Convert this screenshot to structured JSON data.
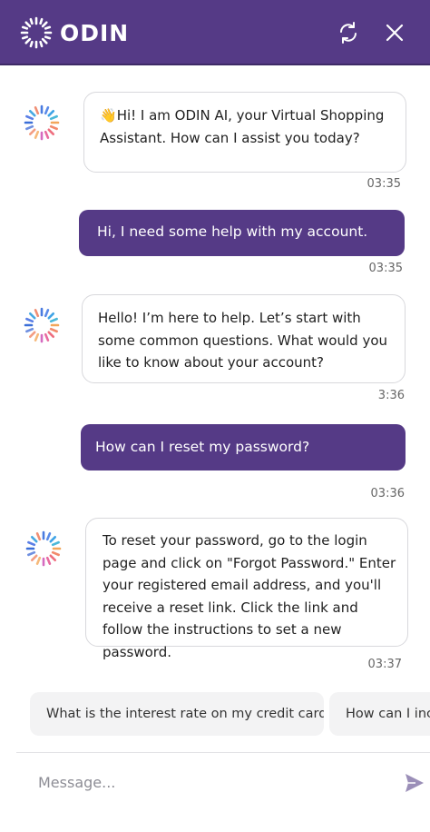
{
  "header": {
    "brand": "ODIN",
    "refresh_icon": "refresh-icon",
    "close_icon": "close-icon",
    "color": "#553a86"
  },
  "messages": [
    {
      "sender": "bot",
      "emoji": "👋",
      "text": "Hi! I am ODIN AI, your Virtual Shopping Assistant. How can I assist you today?",
      "time": "03:35"
    },
    {
      "sender": "user",
      "text": "Hi, I need some help with my account.",
      "time": "03:35"
    },
    {
      "sender": "bot",
      "text": "Hello! I’m here to help. Let’s start with some common questions. What would you like to know about your account?",
      "time": "3:36"
    },
    {
      "sender": "user",
      "text": "How can I reset my password?",
      "time": "03:36"
    },
    {
      "sender": "bot",
      "text": "To reset your password, go to the login page and click on \"Forgot Password.\" Enter your registered email address, and you'll receive a reset link. Click the link and follow the instructions to set a new password.",
      "time": "03:37"
    }
  ],
  "suggestions": [
    "What is the interest rate on my credit card?",
    "How can I incr"
  ],
  "composer": {
    "placeholder": "Message...",
    "send_icon": "send-icon"
  }
}
